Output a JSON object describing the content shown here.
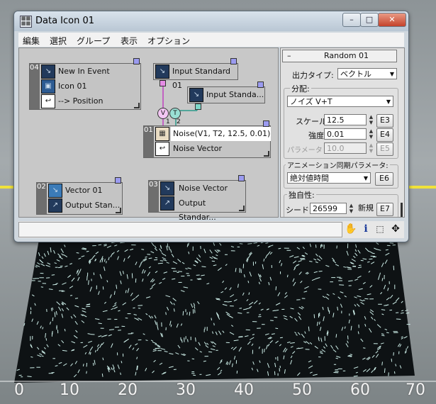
{
  "window": {
    "title": "Data Icon 01",
    "app_icon": "data-grid-icon"
  },
  "title_buttons": {
    "minimize": "–",
    "maximize": "□",
    "close": "✕"
  },
  "menu": [
    "編集",
    "選択",
    "グループ",
    "表示",
    "オプション"
  ],
  "nodes": {
    "n04": {
      "id": "04",
      "title": "New In Event",
      "row2": "Icon 01",
      "row3": "--> Position"
    },
    "input_std1": {
      "label": "Input Standard 01"
    },
    "input_std2": {
      "label": "Input Standa..."
    },
    "n01": {
      "id": "01",
      "title": "Noise(V1, T2, 12.5, 0.01)",
      "row2": "Noise Vector"
    },
    "n02": {
      "id": "02",
      "title": "Vector 01",
      "row2": "Output Stan..."
    },
    "n03": {
      "id": "03",
      "title": "Noise Vector",
      "row2": "Output Standar..."
    }
  },
  "badges": {
    "v": "V",
    "t": "T",
    "v_num": "1",
    "t_num": "2"
  },
  "panel": {
    "rollout_title": "Random 01",
    "rollout_sign": "–",
    "output_type_label": "出力タイプ:",
    "output_type_value": "ベクトル",
    "distribution_group": "分配:",
    "distribution_value": "ノイズ V+T",
    "scale_label": "スケール:",
    "scale_value": "12.5",
    "scale_btn": "E3",
    "strength_label": "強度:",
    "strength_value": "0.01",
    "strength_btn": "E4",
    "param3_label": "パラメータ 3:",
    "param3_value": "10.0",
    "param3_btn": "E5",
    "anim_group": "アニメーション同期パラメータ:",
    "anim_value": "絶対値時間",
    "anim_btn": "E6",
    "unique_group": "独自性:",
    "seed_label": "シード:",
    "seed_value": "26599",
    "new_btn": "新規",
    "seed_btn": "E7"
  },
  "status_icons": [
    "hand-pan-icon",
    "info-icon",
    "region-select-icon",
    "move-arrows-icon"
  ],
  "ruler": [
    "0",
    "10",
    "20",
    "30",
    "40",
    "50",
    "60",
    "70"
  ],
  "colors": {
    "accent_yellow": "#f0e23a",
    "particle": "#cdeee8",
    "wire_teal": "#2a9a8a",
    "wire_magenta": "#c040c0"
  }
}
